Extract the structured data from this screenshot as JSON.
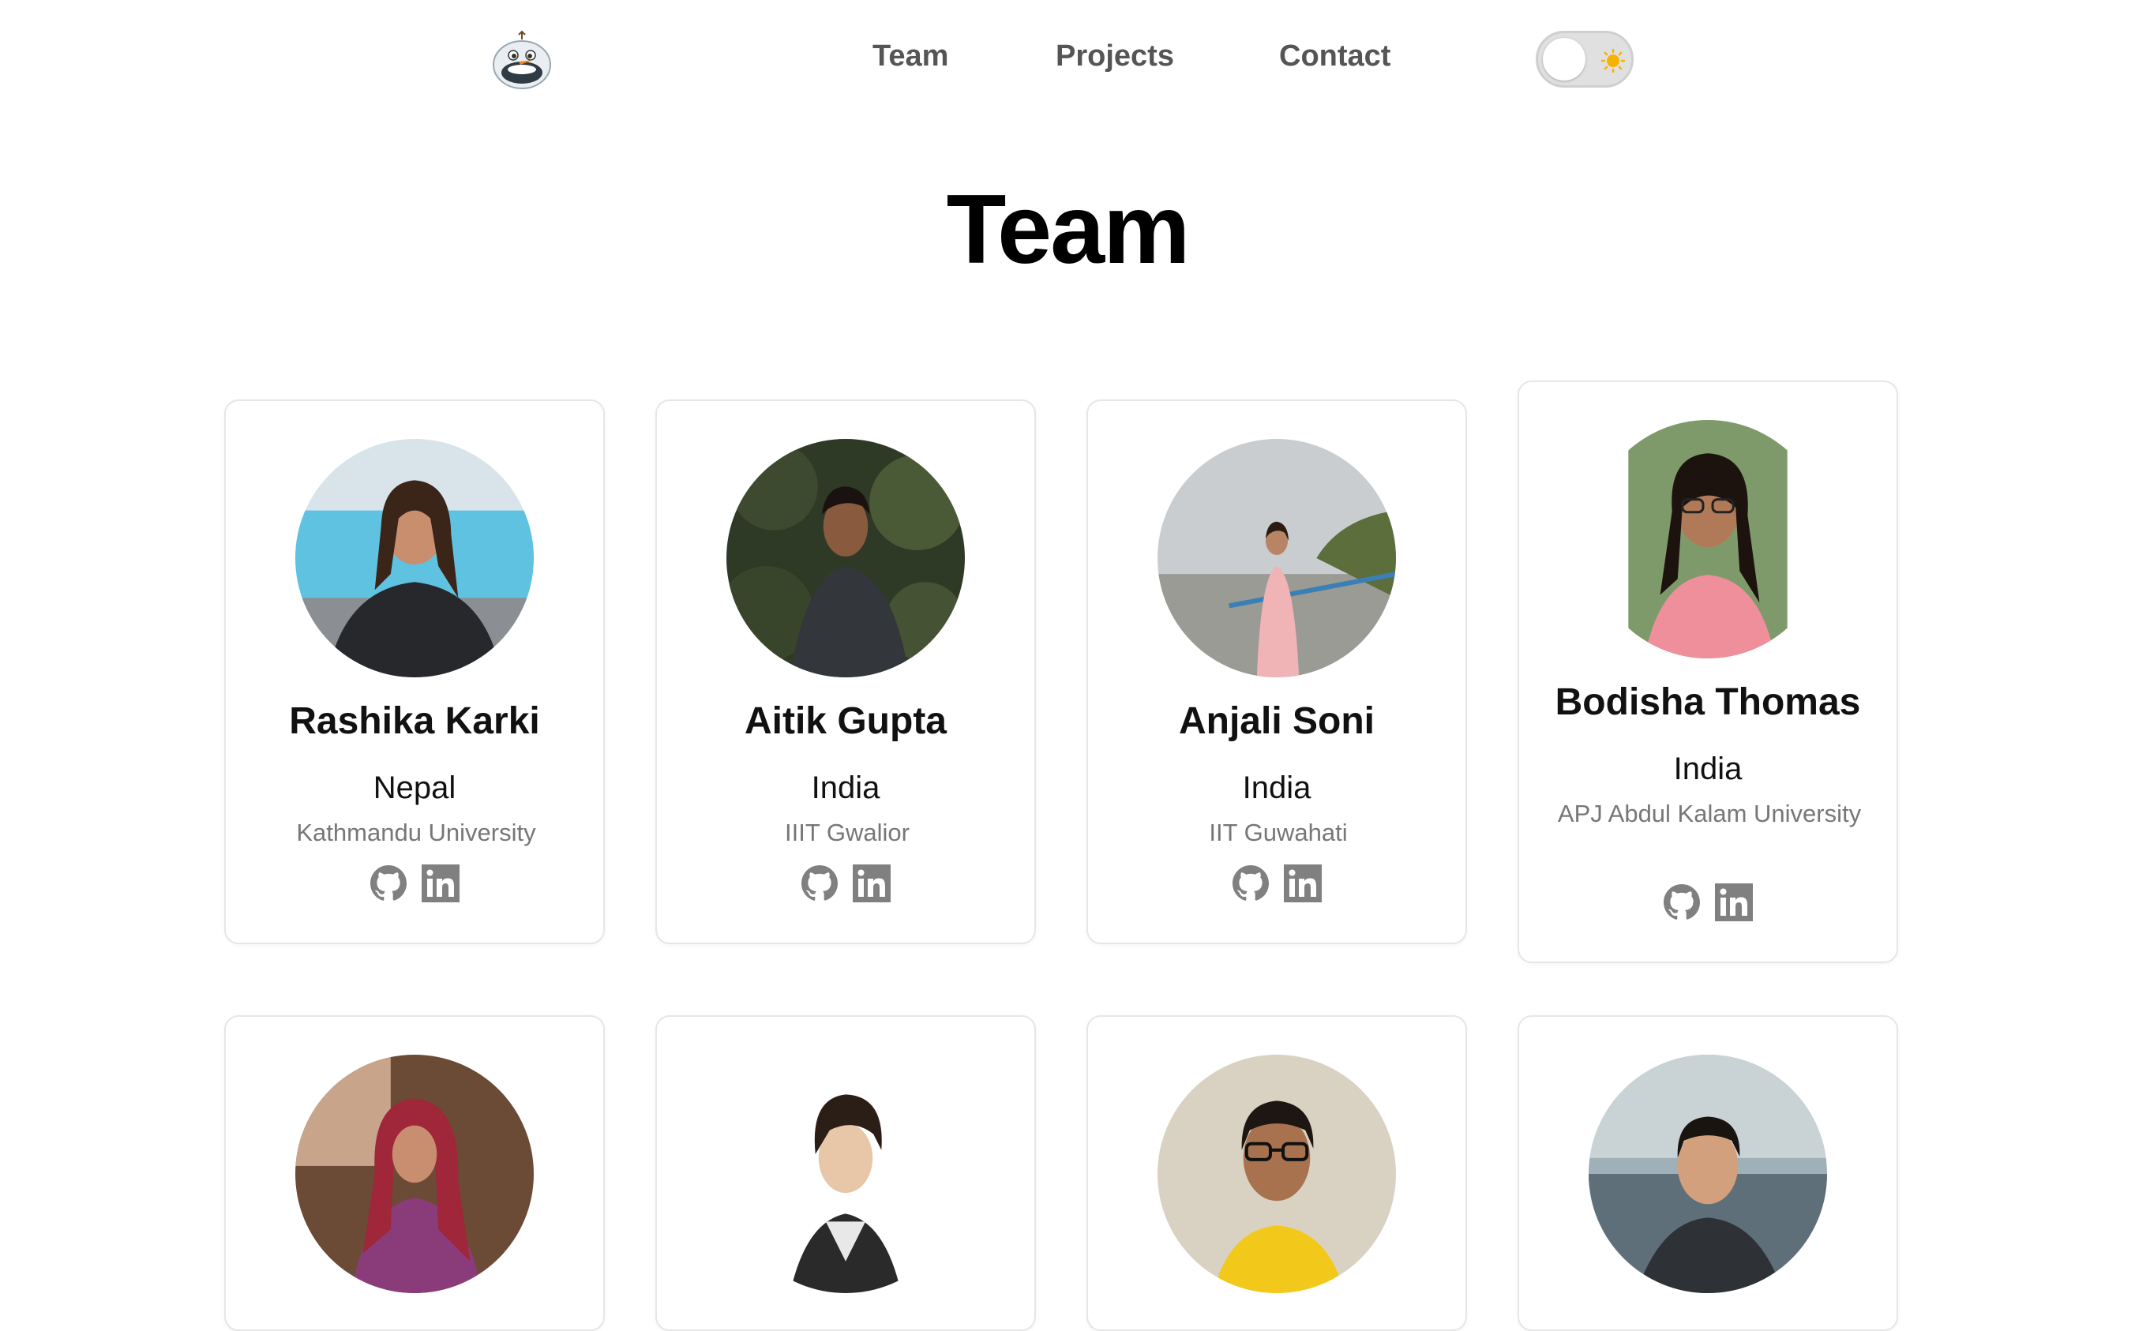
{
  "nav": {
    "logo_icon": "snowman-face-icon",
    "links": [
      "Team",
      "Projects",
      "Contact"
    ],
    "theme_toggle": {
      "state": "light",
      "icon": "sun-icon"
    }
  },
  "page_title": "Team",
  "members": [
    {
      "name": "Rashika Karki",
      "country": "Nepal",
      "university": "Kathmandu University"
    },
    {
      "name": "Aitik Gupta",
      "country": "India",
      "university": "IIIT Gwalior"
    },
    {
      "name": "Anjali Soni",
      "country": "India",
      "university": "IIT Guwahati"
    },
    {
      "name": "Bodisha Thomas",
      "country": "India",
      "university": "APJ Abdul Kalam University"
    }
  ],
  "social_icons": [
    "github-icon",
    "linkedin-icon"
  ],
  "colors": {
    "accent_sun": "#f5b300",
    "muted_text": "#777777",
    "icon_gray": "#808080"
  }
}
